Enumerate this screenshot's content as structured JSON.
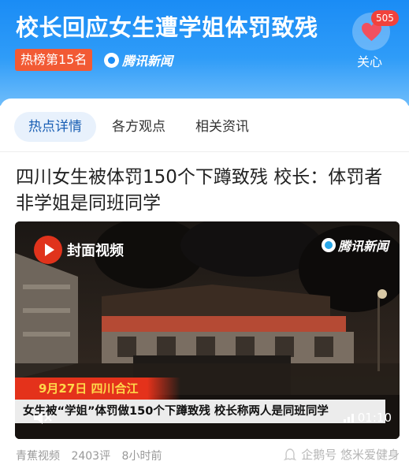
{
  "header": {
    "title": "校长回应女生遭学姐体罚致残",
    "rank_badge": "热榜第15名",
    "source_name": "腾讯新闻",
    "like_count": "505",
    "like_label": "关心",
    "icons": {
      "like": "heart-icon",
      "source": "tencent-news-logo-icon"
    },
    "colors": {
      "header_blue": "#1a8cf5",
      "badge_orange": "#f25a34",
      "count_red": "#f0423c"
    }
  },
  "tabs": [
    {
      "label": "热点详情",
      "active": true
    },
    {
      "label": "各方观点",
      "active": false
    },
    {
      "label": "相关资讯",
      "active": false
    }
  ],
  "article": {
    "headline": "四川女生被体罚150个下蹲致残  校长：体罚者非学姐是同班同学",
    "video": {
      "channel_logo_text": "封面视频",
      "watermark_text": "腾讯新闻",
      "date_location": "9月27日 四川合江",
      "caption": "女生被“学姐”体罚做150个下蹲致残  校长称两人是同班同学",
      "duration": "01:10",
      "icons": {
        "mute": "mute-icon",
        "signal": "signal-icon",
        "channel": "play-logo-icon"
      }
    },
    "meta": {
      "source": "青蕉视频",
      "comments": "2403评",
      "time": "8小时前"
    },
    "attribution": "企鹅号 悠米爱健身"
  }
}
